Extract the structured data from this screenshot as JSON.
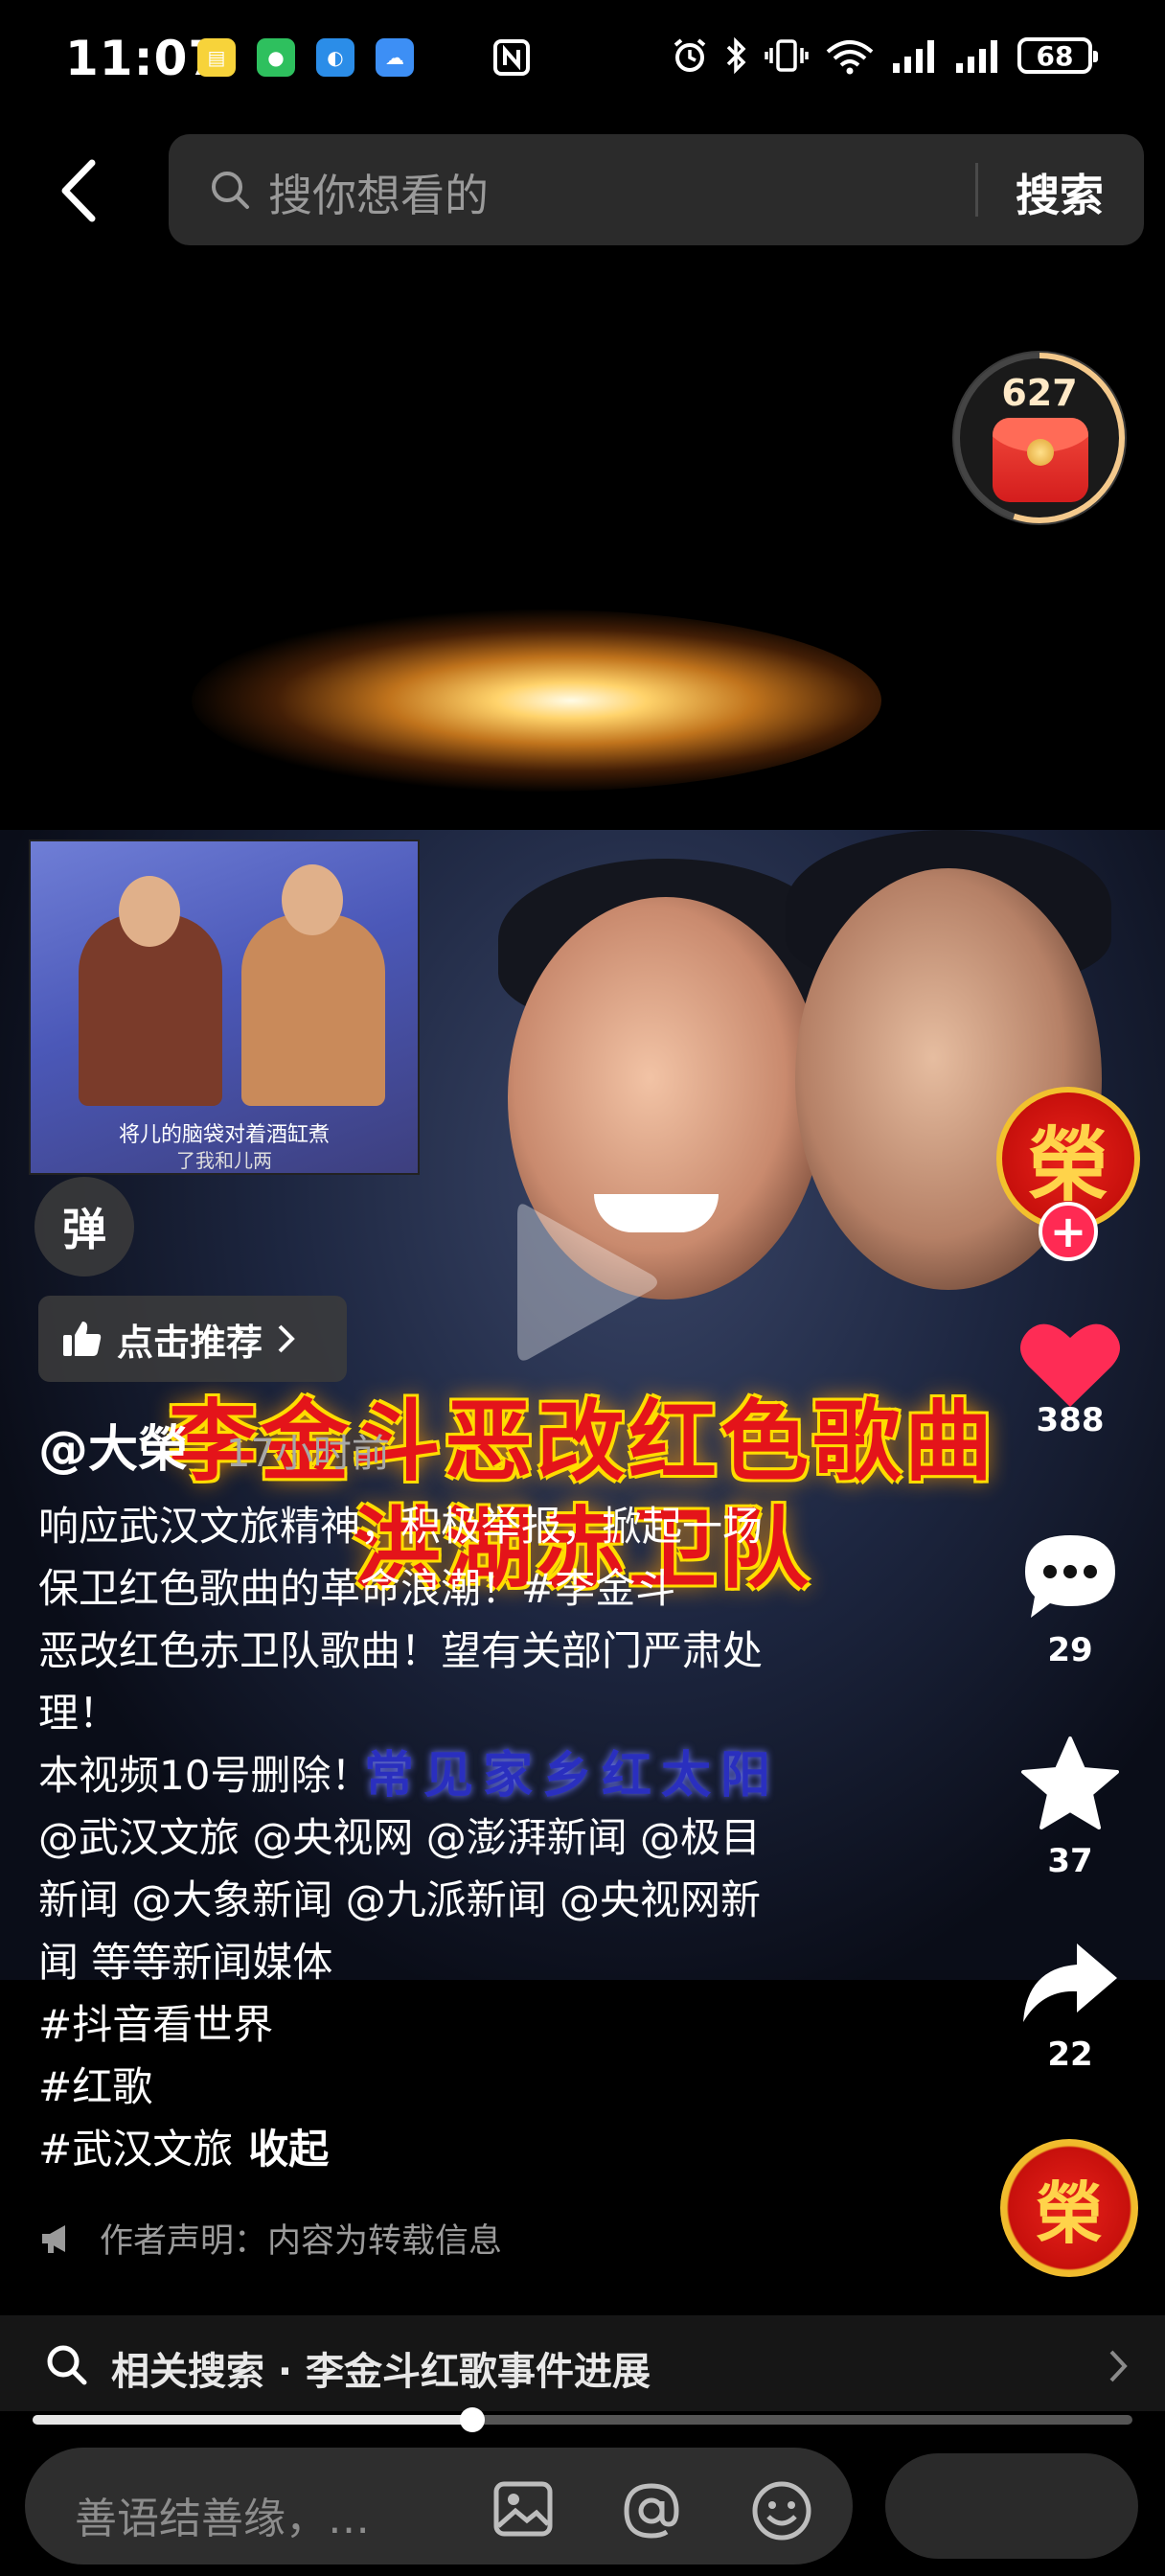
{
  "status_bar": {
    "time": "11:07",
    "battery": "68",
    "app_icons": [
      {
        "name": "toutiao-app-icon",
        "color": "#f7d33a",
        "glyph": "▤"
      },
      {
        "name": "wechat-app-icon",
        "color": "#2ec05e",
        "glyph": "●"
      },
      {
        "name": "browser-app-icon",
        "color": "#2b8de8",
        "glyph": "◐"
      },
      {
        "name": "weather-app-icon",
        "color": "#3d8ff5",
        "glyph": "☁"
      }
    ]
  },
  "search": {
    "placeholder": "搜你想看的",
    "submit_label": "搜索"
  },
  "red_packet": {
    "count": "627",
    "progress_fraction": 0.55
  },
  "video": {
    "inset_caption": "将儿的脑袋对着酒缸煮",
    "inset_caption_2": "了我和儿两",
    "overlay_title_line1": "李金斗恶改红色歌曲",
    "overlay_title_line2": "洪湖赤卫队",
    "overlay_subtitle": "常见家乡红太阳"
  },
  "controls": {
    "danmaku_label": "弹",
    "recommend_label": "点击推荐"
  },
  "post": {
    "author": "@大榮",
    "time": "17小时前",
    "description_lines": [
      "响应武汉文旅精神，积极举报，掀起一场",
      "保卫红色歌曲的革命浪潮！#李金斗",
      "恶改红色赤卫队歌曲！望有关部门严肃处",
      "理！",
      "本视频10号删除！",
      "@武汉文旅 @央视网 @澎湃新闻 @极目",
      "新闻 @大象新闻 @九派新闻 @央视网新",
      "闻 等等新闻媒体",
      "#抖音看世界",
      "#红歌"
    ],
    "last_line_tag": "#武汉文旅",
    "collapse_label": "收起",
    "author_statement": "作者声明：内容为转载信息"
  },
  "rail": {
    "avatar_glyph": "榮",
    "follow_label": "+",
    "likes": "388",
    "comments": "29",
    "favorites": "37",
    "shares": "22",
    "music_glyph": "榮",
    "like_color": "#fe2c55"
  },
  "related": {
    "label": "相关搜索 · 李金斗红歌事件进展"
  },
  "playback": {
    "progress_fraction": 0.4
  },
  "comment_bar": {
    "placeholder": "善语结善缘，…"
  }
}
